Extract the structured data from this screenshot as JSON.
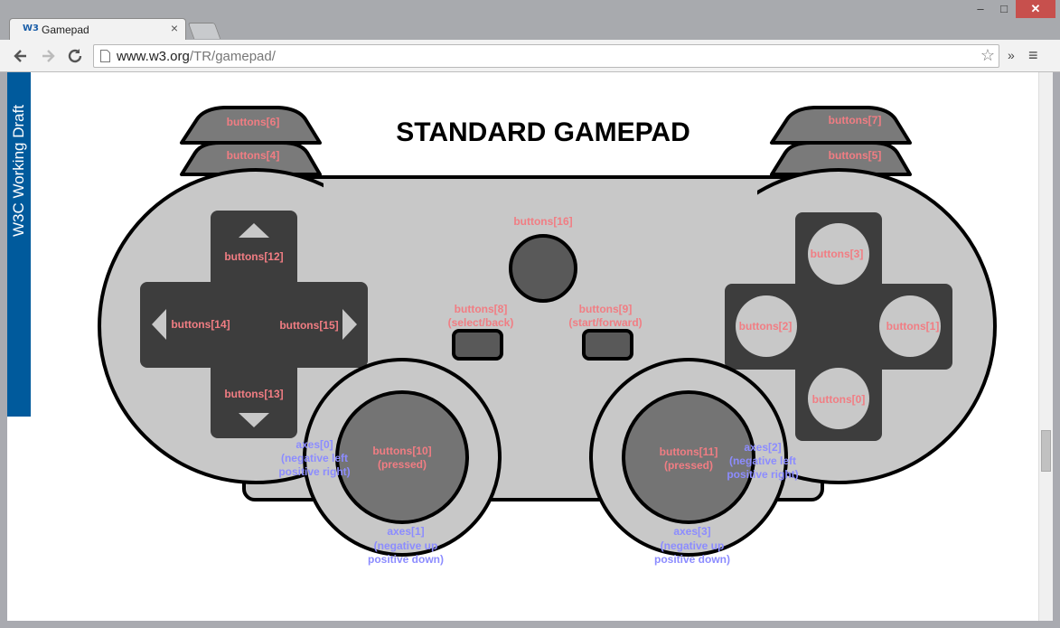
{
  "browser": {
    "tab_title": "Gamepad",
    "tab_favicon": "W3",
    "tab_close": "×",
    "url_host": "www.w3.org",
    "url_path": "/TR/gamepad/",
    "window_minimize": "‒",
    "window_maximize": "□",
    "window_close": "✕",
    "toolbar_more": "»",
    "menu_icon": "≡",
    "back_icon": "arrow-left-icon",
    "forward_icon": "arrow-right-icon",
    "reload_icon": "reload-icon",
    "bookmark_icon": "star-icon"
  },
  "page": {
    "status_badge": "W3C Working Draft",
    "badge_color": "#005a9c",
    "title": "STANDARD GAMEPAD"
  },
  "gamepad": {
    "bumpers": {
      "b6": "buttons[6]",
      "b4": "buttons[4]",
      "b7": "buttons[7]",
      "b5": "buttons[5]"
    },
    "dpad": {
      "up": "buttons[12]",
      "down": "buttons[13]",
      "left": "buttons[14]",
      "right": "buttons[15]"
    },
    "center": {
      "home": "buttons[16]",
      "select_1": "buttons[8]",
      "select_2": "(select/back)",
      "start_1": "buttons[9]",
      "start_2": "(start/forward)"
    },
    "face": {
      "top": "buttons[3]",
      "left": "buttons[2]",
      "right": "buttons[1]",
      "bottom": "buttons[0]"
    },
    "left_stick": {
      "press_1": "buttons[10]",
      "press_2": "(pressed)",
      "axis_x_1": "axes[0]",
      "axis_x_2": "(negative left",
      "axis_x_3": "positive right)",
      "axis_y_1": "axes[1]",
      "axis_y_2": "(negative up",
      "axis_y_3": "positive down)"
    },
    "right_stick": {
      "press_1": "buttons[11]",
      "press_2": "(pressed)",
      "axis_x_1": "axes[2]",
      "axis_x_2": "(negative left",
      "axis_x_3": "positive right)",
      "axis_y_1": "axes[3]",
      "axis_y_2": "(negative up",
      "axis_y_3": "positive down)"
    },
    "colors": {
      "button_label": "#f17d83",
      "axis_label": "#8c8cff",
      "body": "#c8c8c8",
      "dark": "#3d3d3d"
    }
  }
}
